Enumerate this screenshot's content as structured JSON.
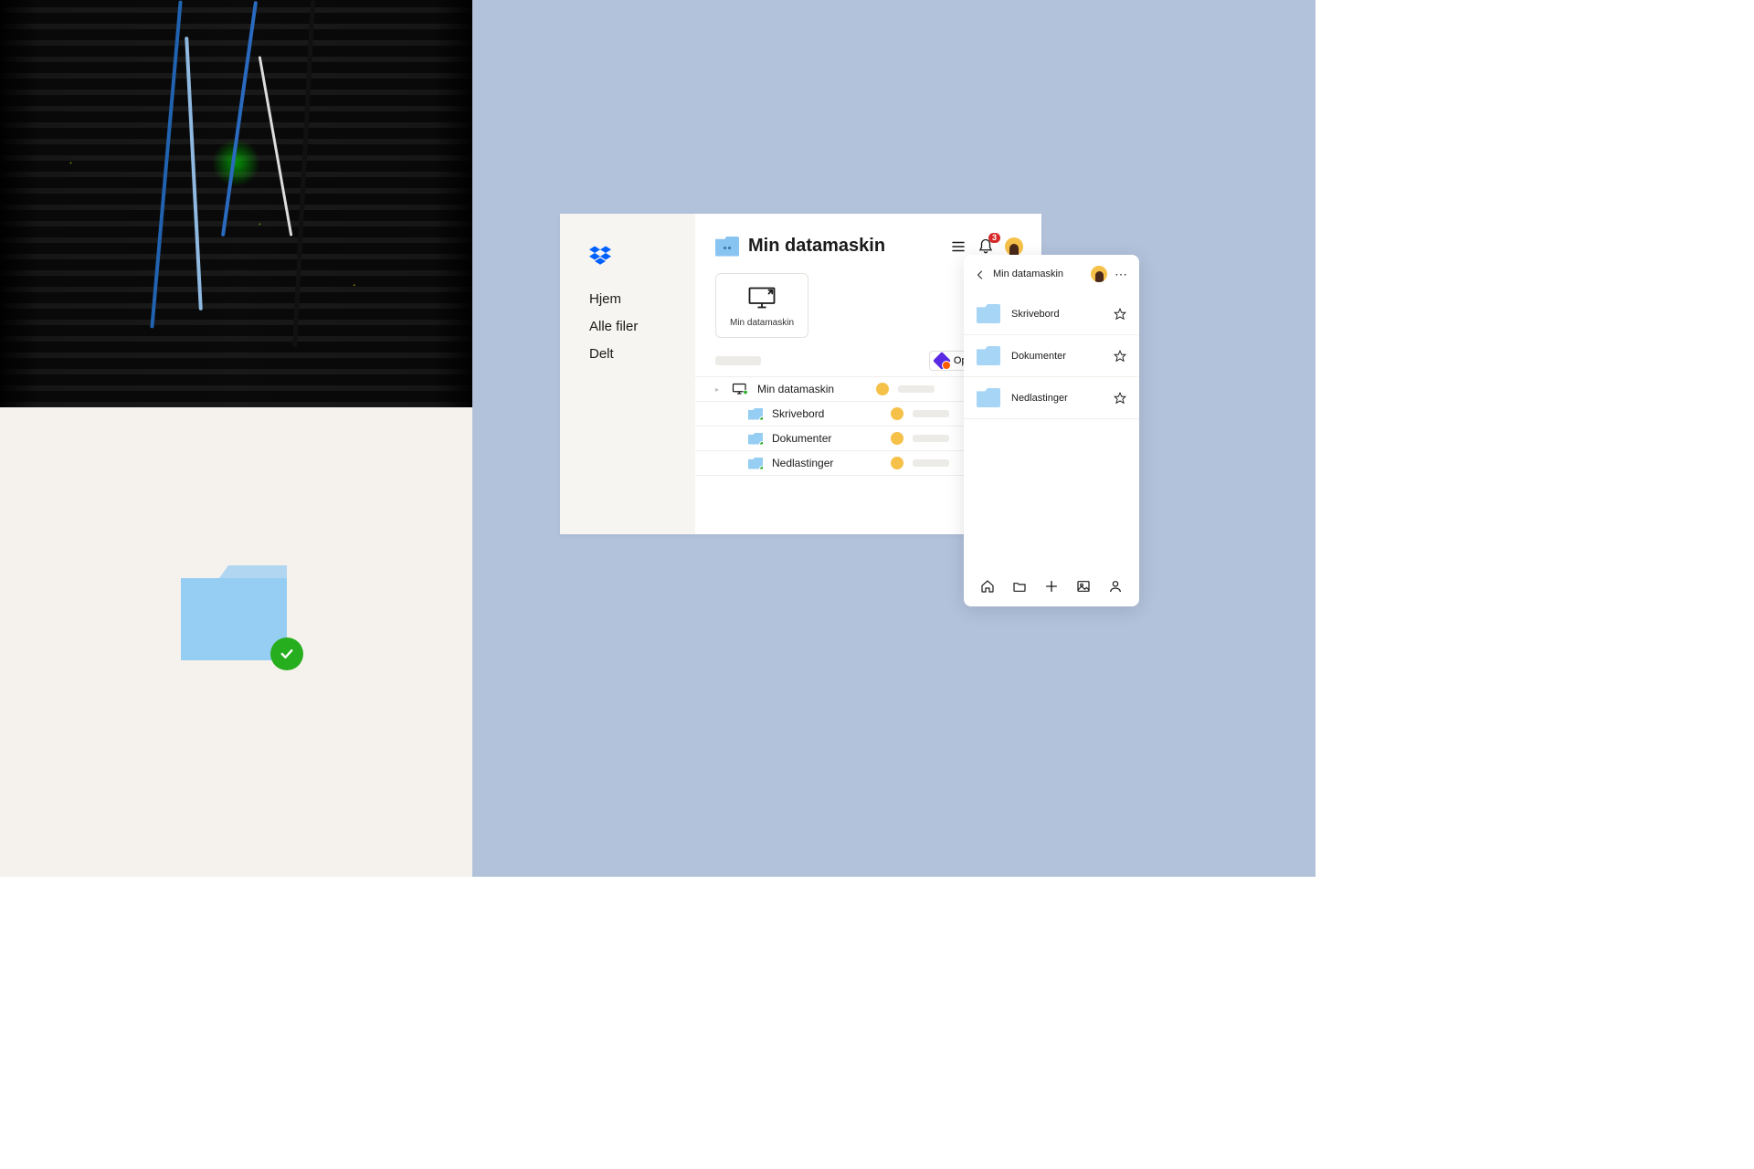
{
  "desktop": {
    "title": "Min datamaskin",
    "nav": {
      "home": "Hjem",
      "all_files": "Alle filer",
      "shared": "Delt"
    },
    "card_label": "Min datamaskin",
    "create_button": "Opprett",
    "notification_count": "3",
    "rows": {
      "0": {
        "name": "Min datamaskin"
      },
      "1": {
        "name": "Skrivebord"
      },
      "2": {
        "name": "Dokumenter"
      },
      "3": {
        "name": "Nedlastinger"
      }
    }
  },
  "mobile": {
    "title": "Min datamaskin",
    "items": {
      "0": {
        "label": "Skrivebord"
      },
      "1": {
        "label": "Dokumenter"
      },
      "2": {
        "label": "Nedlastinger"
      }
    }
  },
  "icons": {
    "folder": "folder",
    "sync_ok": "synced-check"
  },
  "colors": {
    "blue_pale": "#b2c2db",
    "beige": "#f5f2ed",
    "folder_blue": "#96cdf2",
    "accent_green": "#27ae1f",
    "badge_red": "#d62828",
    "dropbox_blue": "#0061fe"
  }
}
